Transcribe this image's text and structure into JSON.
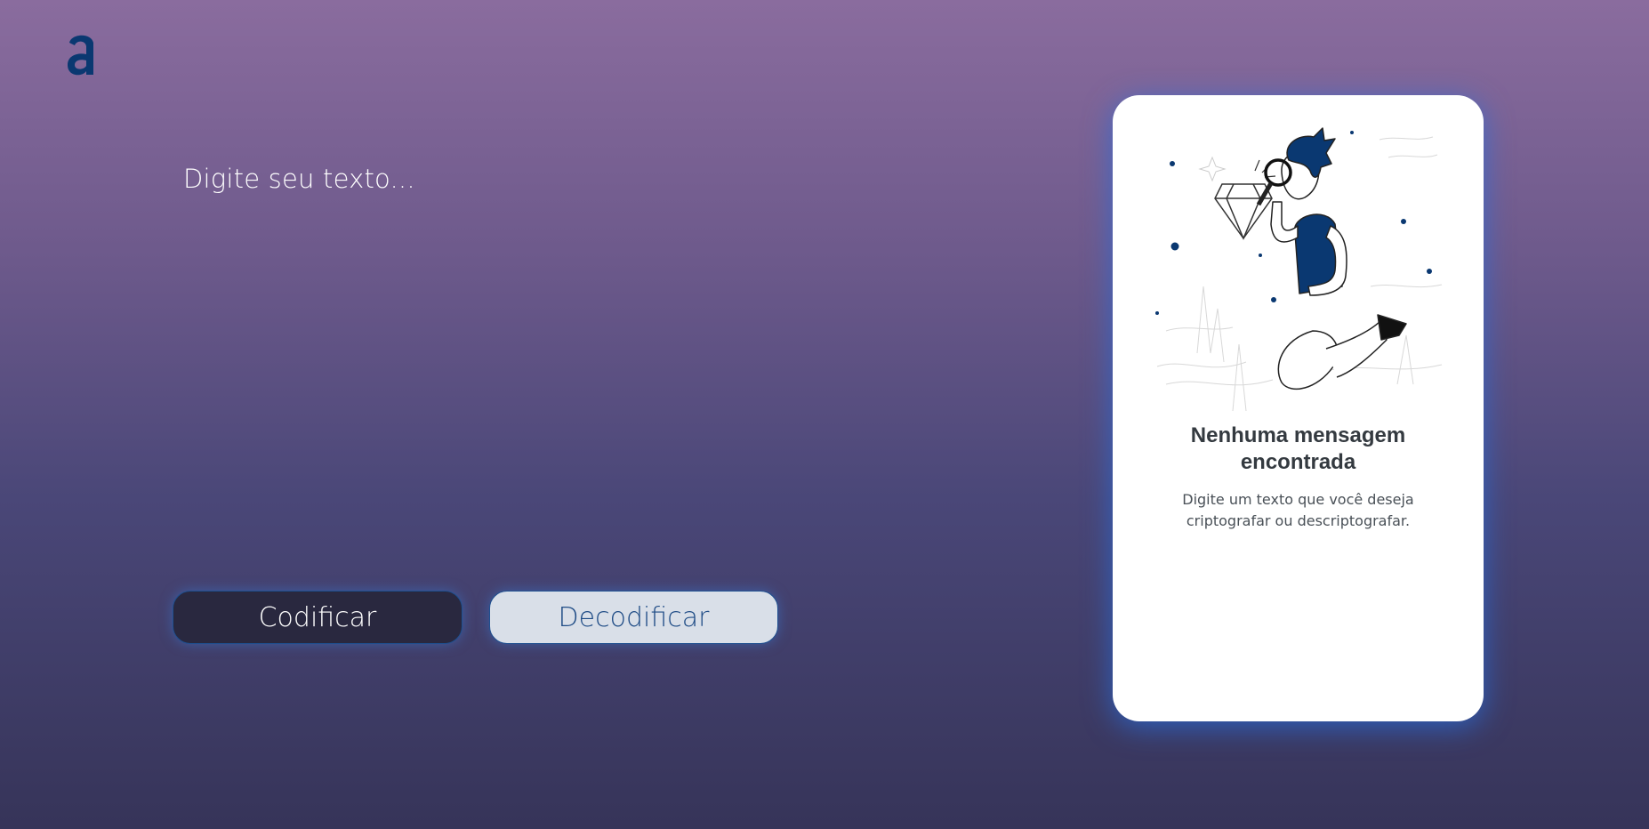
{
  "logo": {
    "icon": "alura-a-logo-icon",
    "color": "#0a3871"
  },
  "input": {
    "placeholder": "Digite seu texto...",
    "value": ""
  },
  "buttons": {
    "encode_label": "Codificar",
    "decode_label": "Decodificar"
  },
  "result_card": {
    "illustration": "person-with-magnifying-glass-icon",
    "title": "Nenhuma mensagem encontrada",
    "description": "Digite um texto que você deseja criptografar ou descriptografar."
  },
  "colors": {
    "accent": "#0a3871",
    "encode_button": "#29283f",
    "decode_button": "#d9dfe8"
  }
}
